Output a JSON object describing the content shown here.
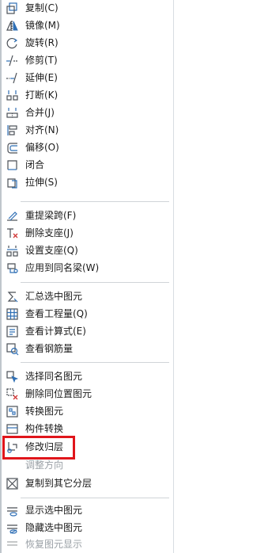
{
  "menu": {
    "items": [
      {
        "label": "复制(C)",
        "icon": "copy-icon",
        "enabled": true
      },
      {
        "label": "镜像(M)",
        "icon": "mirror-icon",
        "enabled": true
      },
      {
        "label": "旋转(R)",
        "icon": "rotate-icon",
        "enabled": true
      },
      {
        "label": "修剪(T)",
        "icon": "trim-icon",
        "enabled": true
      },
      {
        "label": "延伸(E)",
        "icon": "extend-icon",
        "enabled": true
      },
      {
        "label": "打断(K)",
        "icon": "break-icon",
        "enabled": true
      },
      {
        "label": "合并(J)",
        "icon": "merge-icon",
        "enabled": true
      },
      {
        "label": "对齐(N)",
        "icon": "align-icon",
        "enabled": true
      },
      {
        "label": "偏移(O)",
        "icon": "offset-icon",
        "enabled": true
      },
      {
        "label": "闭合",
        "icon": "close-shape-icon",
        "enabled": true
      },
      {
        "label": "拉伸(S)",
        "icon": "stretch-icon",
        "enabled": true
      },
      {
        "label": "重提梁跨(F)",
        "icon": "beam-span-icon",
        "enabled": true
      },
      {
        "label": "删除支座(J)",
        "icon": "delete-support-icon",
        "enabled": true
      },
      {
        "label": "设置支座(Q)",
        "icon": "set-support-icon",
        "enabled": true
      },
      {
        "label": "应用到同名梁(W)",
        "icon": "apply-same-beam-icon",
        "enabled": true
      },
      {
        "label": "汇总选中图元",
        "icon": "sum-icon",
        "enabled": true
      },
      {
        "label": "查看工程量(Q)",
        "icon": "quantity-icon",
        "enabled": true
      },
      {
        "label": "查看计算式(E)",
        "icon": "formula-icon",
        "enabled": true
      },
      {
        "label": "查看钢筋量",
        "icon": "rebar-icon",
        "enabled": true
      },
      {
        "label": "选择同名图元",
        "icon": "select-same-icon",
        "enabled": true
      },
      {
        "label": "删除同位置图元",
        "icon": "delete-same-pos-icon",
        "enabled": true
      },
      {
        "label": "转换图元",
        "icon": "convert-icon",
        "enabled": true
      },
      {
        "label": "构件转换",
        "icon": "component-convert-icon",
        "enabled": true
      },
      {
        "label": "修改归层",
        "icon": "change-layer-icon",
        "enabled": true
      },
      {
        "label": "调整方向",
        "icon": "adjust-direction-icon",
        "enabled": false
      },
      {
        "label": "复制到其它分层",
        "icon": "copy-to-layer-icon",
        "enabled": true
      },
      {
        "label": "显示选中图元",
        "icon": "show-selected-icon",
        "enabled": true
      },
      {
        "label": "隐藏选中图元",
        "icon": "hide-selected-icon",
        "enabled": true
      },
      {
        "label": "恢复图元显示",
        "icon": "restore-display-icon",
        "enabled": false
      }
    ]
  },
  "colors": {
    "highlight_border": "#e0151b",
    "disabled_text": "#9aa0a6",
    "icon_blue": "#2f6fb5"
  }
}
